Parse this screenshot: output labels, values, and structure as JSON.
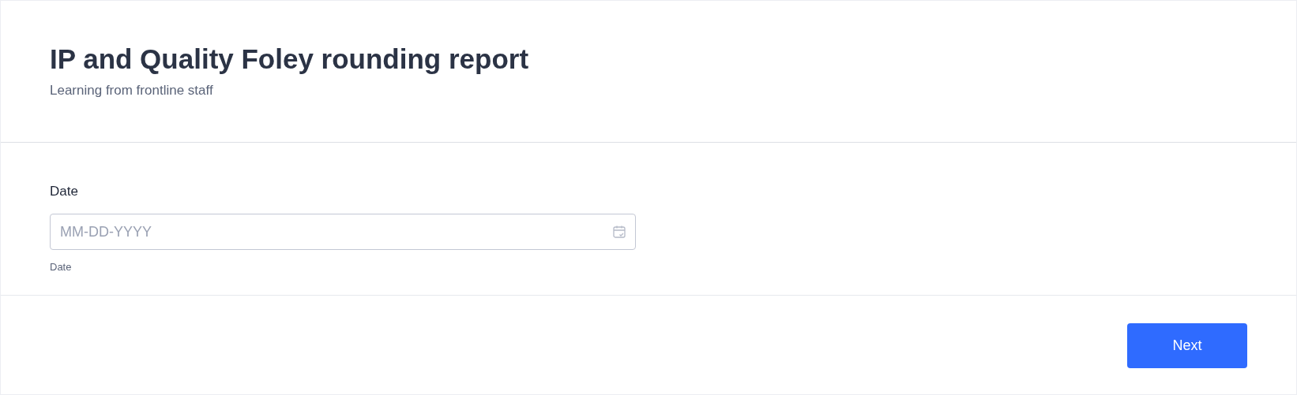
{
  "header": {
    "title": "IP and Quality Foley rounding report",
    "subtitle": "Learning from frontline staff"
  },
  "field": {
    "label": "Date",
    "placeholder": "MM-DD-YYYY",
    "hint": "Date"
  },
  "buttons": [
    {
      "label": "Next",
      "kind": "primary"
    }
  ]
}
